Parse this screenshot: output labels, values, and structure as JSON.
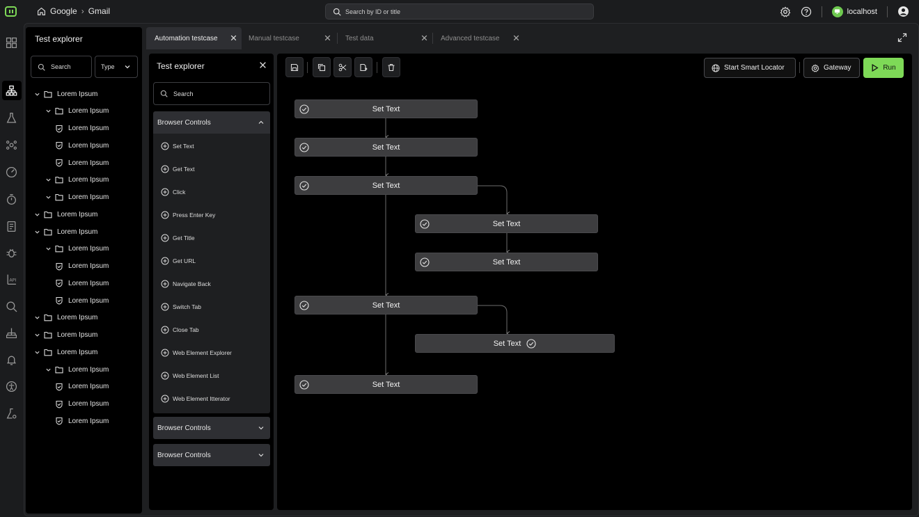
{
  "breadcrumb": {
    "items": [
      "Google",
      "Gmail"
    ]
  },
  "top_search": {
    "placeholder": "Search by ID or title"
  },
  "host": {
    "label": "localhost"
  },
  "explorer": {
    "title": "Test explorer",
    "search_placeholder": "Search",
    "type_label": "Type",
    "tree": [
      {
        "label": "Lorem Ipsum",
        "kind": "folder",
        "depth": 0
      },
      {
        "label": "Lorem Ipsum",
        "kind": "folder",
        "depth": 1
      },
      {
        "label": "Lorem Ipsum",
        "kind": "test",
        "depth": 2
      },
      {
        "label": "Lorem Ipsum",
        "kind": "test",
        "depth": 2
      },
      {
        "label": "Lorem Ipsum",
        "kind": "test",
        "depth": 2
      },
      {
        "label": "Lorem Ipsum",
        "kind": "folder",
        "depth": 1
      },
      {
        "label": "Lorem Ipsum",
        "kind": "folder",
        "depth": 1
      },
      {
        "label": "Lorem Ipsum",
        "kind": "folder",
        "depth": 0
      },
      {
        "label": "Lorem Ipsum",
        "kind": "folder",
        "depth": 0
      },
      {
        "label": "Lorem Ipsum",
        "kind": "folder",
        "depth": 1
      },
      {
        "label": "Lorem Ipsum",
        "kind": "test",
        "depth": 2
      },
      {
        "label": "Lorem Ipsum",
        "kind": "test",
        "depth": 2
      },
      {
        "label": "Lorem Ipsum",
        "kind": "test",
        "depth": 2
      },
      {
        "label": "Lorem Ipsum",
        "kind": "folder",
        "depth": 0
      },
      {
        "label": "Lorem Ipsum",
        "kind": "folder",
        "depth": 0
      },
      {
        "label": "Lorem Ipsum",
        "kind": "folder",
        "depth": 0
      },
      {
        "label": "Lorem Ipsum",
        "kind": "folder",
        "depth": 1
      },
      {
        "label": "Lorem Ipsum",
        "kind": "test",
        "depth": 2
      },
      {
        "label": "Lorem Ipsum",
        "kind": "test",
        "depth": 2
      },
      {
        "label": "Lorem Ipsum",
        "kind": "test",
        "depth": 2
      }
    ]
  },
  "tabs": [
    {
      "label": "Automation testcase",
      "active": true
    },
    {
      "label": "Manual testcase",
      "active": false
    },
    {
      "label": "Test data",
      "active": false
    },
    {
      "label": "Advanced testcase",
      "active": false
    }
  ],
  "palette": {
    "title": "Test explorer",
    "search_placeholder": "Search",
    "sections": [
      {
        "label": "Browser Controls",
        "expanded": true,
        "items": [
          "Set Text",
          "Get Text",
          "Click",
          "Press Enter Key",
          "Get Title",
          "Get URL",
          "Navigate Back",
          "Switch Tab",
          "Close Tab",
          "Web Element Explorer",
          "Web Element List",
          "Web Element Itterator"
        ]
      },
      {
        "label": "Browser Controls",
        "expanded": false,
        "items": []
      },
      {
        "label": "Browser Controls",
        "expanded": false,
        "items": []
      }
    ]
  },
  "toolbar": {
    "smart_locator_label": "Start Smart Locator",
    "gateway_label": "Gateway",
    "run_label": "Run",
    "icons": [
      "save-icon",
      "copy-icon",
      "cut-icon",
      "paste-icon",
      "delete-icon"
    ]
  },
  "flow": {
    "nodes": [
      {
        "label": "Set Text",
        "check": "left"
      },
      {
        "label": "Set Text",
        "check": "left"
      },
      {
        "label": "Set Text",
        "check": "left"
      },
      {
        "label": "Set Text",
        "check": "left"
      },
      {
        "label": "Set Text",
        "check": "left"
      },
      {
        "label": "Set Text",
        "check": "left"
      },
      {
        "label": "Set Text",
        "check": "inline"
      },
      {
        "label": "Set Text",
        "check": "left"
      }
    ]
  },
  "colors": {
    "accent": "#7ed957",
    "background": "#000000",
    "node": "#3d3d3f"
  }
}
